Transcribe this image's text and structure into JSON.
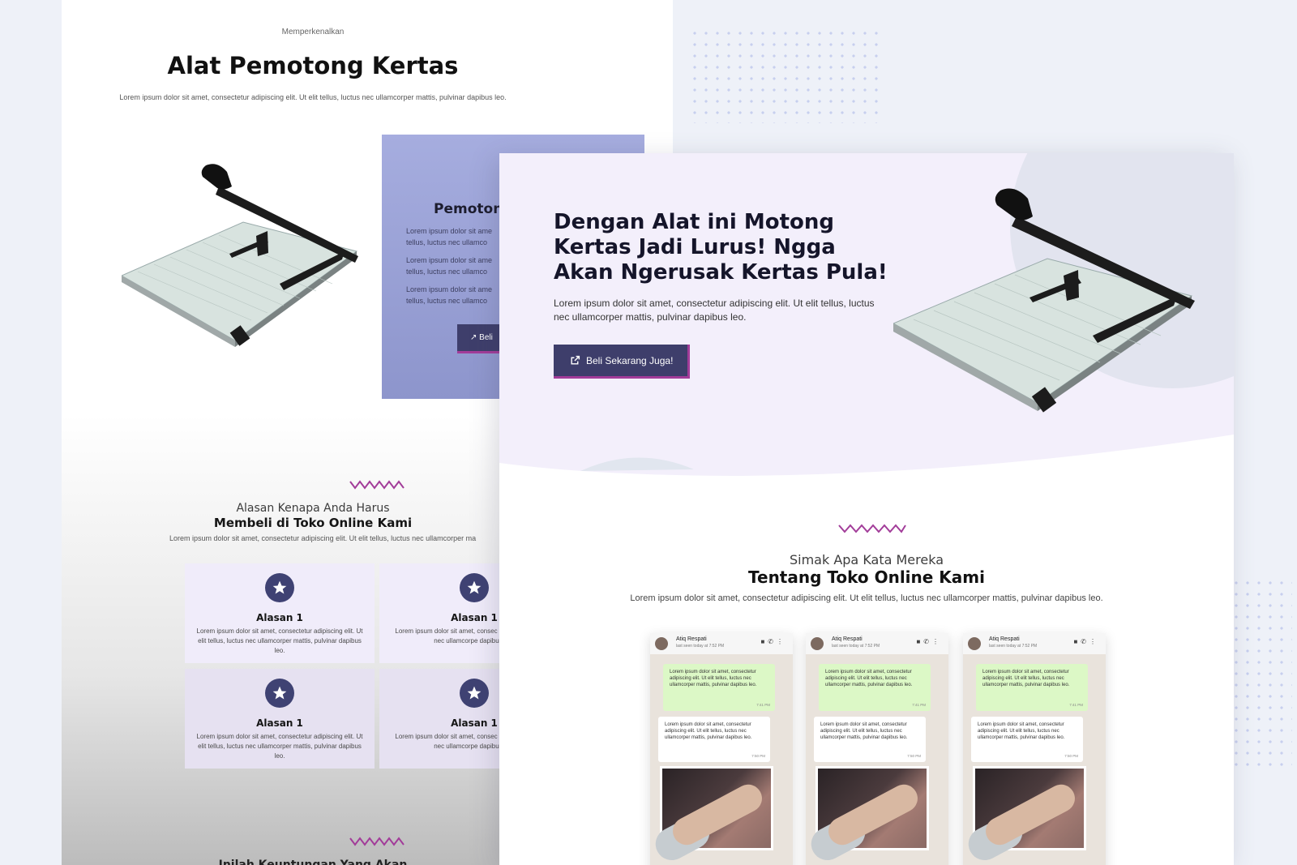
{
  "back_page": {
    "eyebrow": "Memperkenalkan",
    "title": "Alat Pemotong Kertas",
    "description": "Lorem ipsum dolor sit amet, consectetur adipiscing elit. Ut elit tellus, luctus nec ullamcorper mattis, pulvinar dapibus leo.",
    "product_card": {
      "title": "Pemoton",
      "lines": [
        [
          "Lorem ipsum dolor sit ame",
          "tellus, luctus nec ullamco"
        ],
        [
          "Lorem ipsum dolor sit ame",
          "tellus, luctus nec ullamco"
        ],
        [
          "Lorem ipsum dolor sit ame",
          "tellus, luctus nec ullamco"
        ]
      ],
      "button_label": "Beli"
    },
    "reasons": {
      "subtitle": "Alasan Kenapa Anda Harus",
      "title": "Membeli di Toko Online Kami",
      "description": "Lorem ipsum dolor sit amet, consectetur adipiscing elit. Ut elit tellus, luctus nec ullamcorper ma",
      "cards": [
        {
          "title": "Alasan 1",
          "text": "Lorem ipsum dolor sit amet, consectetur adipiscing elit. Ut elit tellus, luctus nec ullamcorper mattis, pulvinar dapibus leo."
        },
        {
          "title": "Alasan 1",
          "text": "Lorem ipsum dolor sit amet, consec Ut elit tellus, luctus nec ullamcorpe dapibus leo."
        },
        {
          "title": "Alasan 1",
          "text": "Lorem ipsum dolor sit amet, consectetur adipiscing elit. Ut elit tellus, luctus nec ullamcorper mattis, pulvinar dapibus leo."
        },
        {
          "title": "Alasan 1",
          "text": "Lorem ipsum dolor sit amet, consec Ut elit tellus, luctus nec ullamcorpe dapibus leo."
        }
      ]
    },
    "bottom_title": "Inilah Keuntungan Yang Akan"
  },
  "front_page": {
    "hero": {
      "title": "Dengan Alat ini Motong Kertas Jadi Lurus! Ngga Akan Ngerusak Kertas Pula!",
      "description": "Lorem ipsum dolor sit amet, consectetur adipiscing elit. Ut elit tellus, luctus nec ullamcorper mattis, pulvinar dapibus leo.",
      "button_label": "Beli Sekarang Juga!"
    },
    "testimonials": {
      "subtitle": "Simak Apa Kata Mereka",
      "title": "Tentang Toko Online Kami",
      "description": "Lorem ipsum dolor sit amet, consectetur adipiscing elit. Ut elit tellus, luctus nec ullamcorper mattis, pulvinar dapibus leo.",
      "chats": [
        {
          "name": "Atiq Respati",
          "seen": "last seen today at 7:52 PM",
          "out_text": "Lorem ipsum dolor sit amet, consectetur adipiscing elit. Ut elit tellus, luctus nec ullamcorper mattis, pulvinar dapibus leo.",
          "out_time": "7:41 PM",
          "in_text": "Lorem ipsum dolor sit amet, consectetur adipiscing elit. Ut elit tellus, luctus nec ullamcorper mattis, pulvinar dapibus leo.",
          "in_time": "7:50 PM"
        },
        {
          "name": "Atiq Respati",
          "seen": "last seen today at 7:52 PM",
          "out_text": "Lorem ipsum dolor sit amet, consectetur adipiscing elit. Ut elit tellus, luctus nec ullamcorper mattis, pulvinar dapibus leo.",
          "out_time": "7:41 PM",
          "in_text": "Lorem ipsum dolor sit amet, consectetur adipiscing elit. Ut elit tellus, luctus nec ullamcorper mattis, pulvinar dapibus leo.",
          "in_time": "7:50 PM"
        },
        {
          "name": "Atiq Respati",
          "seen": "last seen today at 7:52 PM",
          "out_text": "Lorem ipsum dolor sit amet, consectetur adipiscing elit. Ut elit tellus, luctus nec ullamcorper mattis, pulvinar dapibus leo.",
          "out_time": "7:41 PM",
          "in_text": "Lorem ipsum dolor sit amet, consectetur adipiscing elit. Ut elit tellus, luctus nec ullamcorper mattis, pulvinar dapibus leo.",
          "in_time": "7:50 PM"
        }
      ]
    }
  },
  "colors": {
    "accent": "#3e3e6b",
    "accent_border": "#a23c99",
    "hero_bg": "#f3effb",
    "card_bg": "#f0ecfa",
    "zigzag": "#a23c99"
  },
  "icons": [
    "star-icon",
    "external-link-icon",
    "video-icon",
    "phone-icon",
    "more-icon",
    "paper-cutter-image"
  ]
}
